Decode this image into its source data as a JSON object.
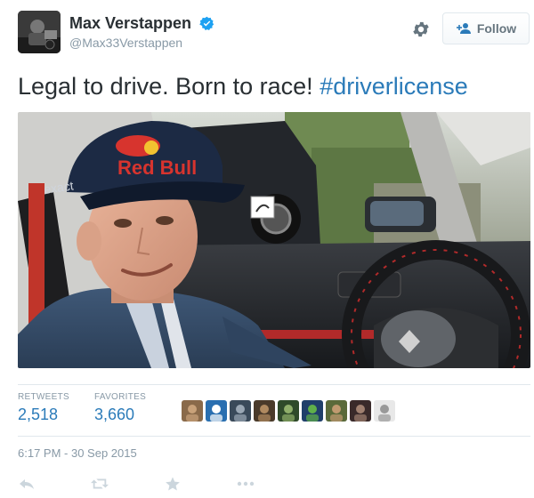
{
  "user": {
    "display_name": "Max Verstappen",
    "handle": "@Max33Verstappen",
    "verified": true
  },
  "toolbar": {
    "settings_icon": "gear-icon",
    "follow_label": "Follow",
    "follow_icon": "add-user-icon"
  },
  "tweet": {
    "text": "Legal to drive. Born to race! ",
    "hashtag": "#driverlicense",
    "hashtag_color": "#2b7bb9"
  },
  "photo": {
    "cap_text": "Red Bull",
    "cap_side_text": "exact"
  },
  "stats": {
    "retweets_label": "RETWEETS",
    "retweets_value": "2,518",
    "favorites_label": "FAVORITES",
    "favorites_value": "3,660"
  },
  "favoriters": [
    {
      "color": "#8a6a4a",
      "accent": "#c9a27a"
    },
    {
      "color": "#2a6fb0",
      "accent": "#ffffff"
    },
    {
      "color": "#3a4a5a",
      "accent": "#9aa7b4"
    },
    {
      "color": "#4a3a2a",
      "accent": "#b08a60"
    },
    {
      "color": "#2f4a2a",
      "accent": "#8fae6a"
    },
    {
      "color": "#1f3f6a",
      "accent": "#5fb04a"
    },
    {
      "color": "#5a6a3a",
      "accent": "#c09a70"
    },
    {
      "color": "#3a2a2a",
      "accent": "#a08070"
    },
    {
      "color": "#e8e8e8",
      "accent": "#999999"
    }
  ],
  "timestamp": "6:17 PM - 30 Sep 2015",
  "actions": {
    "reply_icon": "reply-icon",
    "retweet_icon": "retweet-icon",
    "favorite_icon": "star-icon",
    "more_icon": "more-icon"
  },
  "colors": {
    "accent": "#2b7bb9",
    "muted": "#8899a6",
    "text": "#292f33",
    "border": "#e1e8ed"
  }
}
